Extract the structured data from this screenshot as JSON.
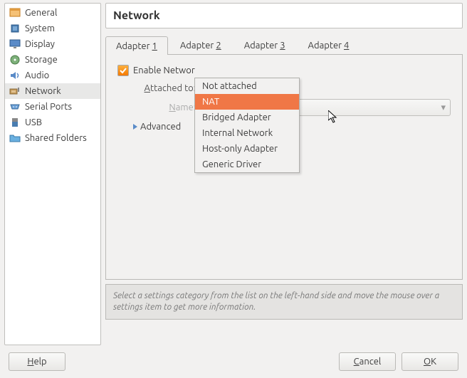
{
  "sidebar": {
    "items": [
      {
        "label": "General"
      },
      {
        "label": "System"
      },
      {
        "label": "Display"
      },
      {
        "label": "Storage"
      },
      {
        "label": "Audio"
      },
      {
        "label": "Network"
      },
      {
        "label": "Serial Ports"
      },
      {
        "label": "USB"
      },
      {
        "label": "Shared Folders"
      }
    ]
  },
  "main": {
    "title": "Network",
    "tabs": [
      {
        "prefix": "Adapter ",
        "num": "1"
      },
      {
        "prefix": "Adapter ",
        "num": "2"
      },
      {
        "prefix": "Adapter ",
        "num": "3"
      },
      {
        "prefix": "Adapter ",
        "num": "4"
      }
    ],
    "enable_label": "Enable Network Adapter",
    "enable_label_visible": "Enable Networ",
    "attached_prefix": "A",
    "attached_rest": "ttached to:",
    "name_prefix": "N",
    "name_rest": "ame:",
    "advanced_prefix": "A",
    "advanced_rest": "dvanced",
    "dropdown": [
      "Not attached",
      "NAT",
      "Bridged Adapter",
      "Internal Network",
      "Host-only Adapter",
      "Generic Driver"
    ],
    "selected_option": "NAT"
  },
  "hint": "Select a settings category from the list on the left-hand side and move the mouse over a settings item to get more information.",
  "footer": {
    "help": "Help",
    "cancel": "Cancel",
    "ok": "OK"
  }
}
